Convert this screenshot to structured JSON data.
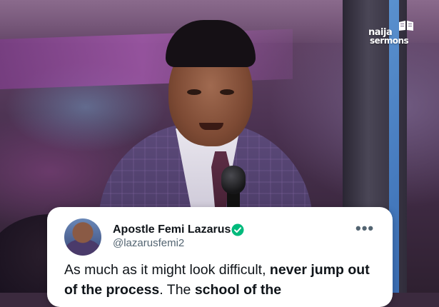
{
  "logo": {
    "line1": "naija",
    "line2": "sermons",
    "icon": "open-book-icon"
  },
  "tweet": {
    "author_name": "Apostle Femi Lazarus",
    "handle": "@lazarusfemi2",
    "verified_icon": "verified-badge-icon",
    "more_icon": "more-options-icon",
    "text_segments": [
      {
        "text": "As much as it might look difficult, ",
        "bold": false
      },
      {
        "text": "never jump out of the process",
        "bold": true
      },
      {
        "text": ". The ",
        "bold": false
      },
      {
        "text": "school of the",
        "bold": true
      }
    ]
  },
  "colors": {
    "verified_badge": "#00ba7c",
    "card_background": "#ffffff",
    "handle_text": "#536471",
    "name_text": "#0f1419"
  }
}
